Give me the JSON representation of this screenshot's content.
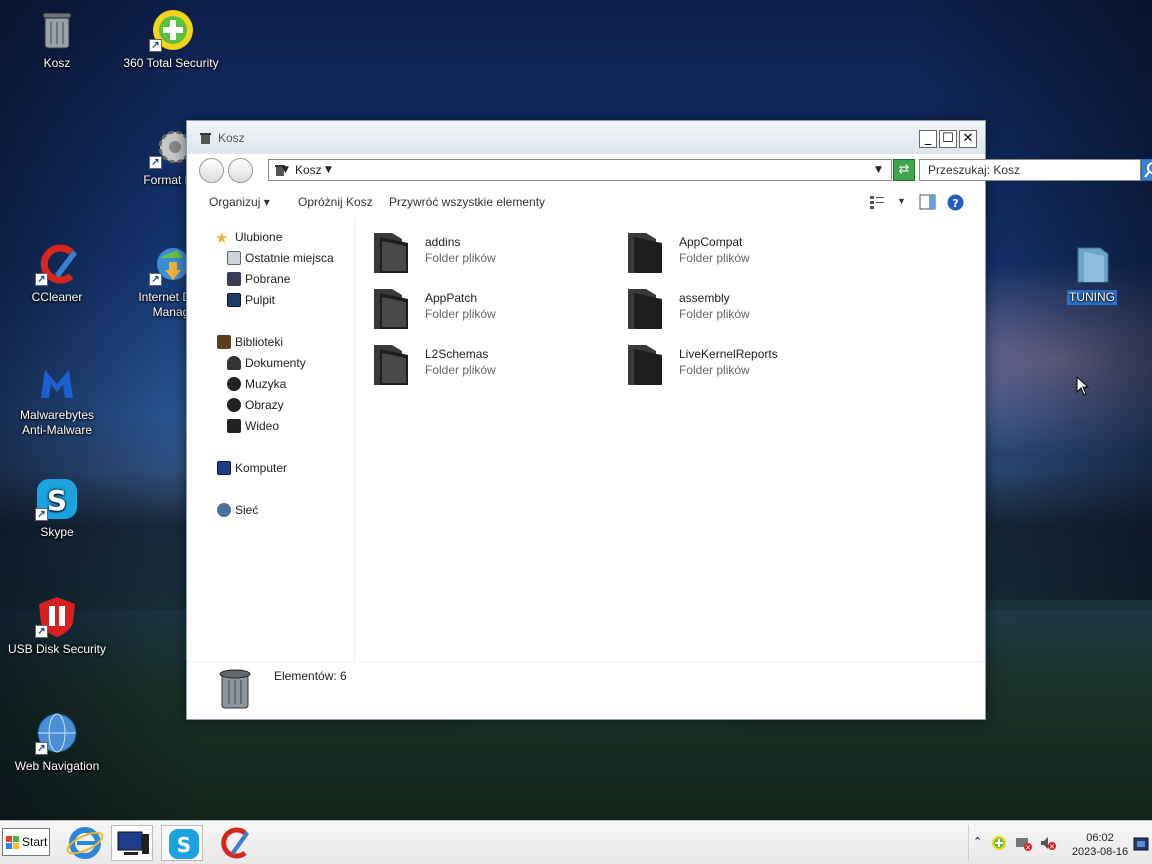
{
  "desktop": {
    "icons": [
      {
        "label": "Kosz"
      },
      {
        "label": "360 Total Security"
      },
      {
        "label": "Format Fa"
      },
      {
        "label": "CCleaner"
      },
      {
        "label": "Internet Dov\nManag"
      },
      {
        "label": "Malwarebytes\nAnti-Malware"
      },
      {
        "label": "Skype"
      },
      {
        "label": "USB Disk Security"
      },
      {
        "label": "Web Navigation"
      },
      {
        "label": "TUNING"
      }
    ]
  },
  "window": {
    "title": "Kosz",
    "address": {
      "crumb": "Kosz"
    },
    "search": {
      "placeholder": "Przeszukaj: Kosz"
    },
    "toolbar": {
      "organize": "Organizuj",
      "empty": "Opróżnij Kosz",
      "restore_all": "Przywróć wszystkie elementy"
    },
    "nav": {
      "favorites": "Ulubione",
      "recent": "Ostatnie miejsca",
      "downloads": "Pobrane",
      "desktop": "Pulpit",
      "libraries": "Biblioteki",
      "documents": "Dokumenty",
      "music": "Muzyka",
      "pictures": "Obrazy",
      "videos": "Wideo",
      "computer": "Komputer",
      "network": "Sieć"
    },
    "items": [
      {
        "name": "addins",
        "type": "Folder plików"
      },
      {
        "name": "AppCompat",
        "type": "Folder plików"
      },
      {
        "name": "AppPatch",
        "type": "Folder plików"
      },
      {
        "name": "assembly",
        "type": "Folder plików"
      },
      {
        "name": "L2Schemas",
        "type": "Folder plików"
      },
      {
        "name": "LiveKernelReports",
        "type": "Folder plików"
      }
    ],
    "details": {
      "count_text": "Elementów: 6"
    }
  },
  "taskbar": {
    "start_label": "Start",
    "clock_time": "06:02",
    "clock_date": "2023-08-16"
  },
  "colors": {
    "accent": "#3fa54a",
    "selection": "#2f73c7"
  }
}
